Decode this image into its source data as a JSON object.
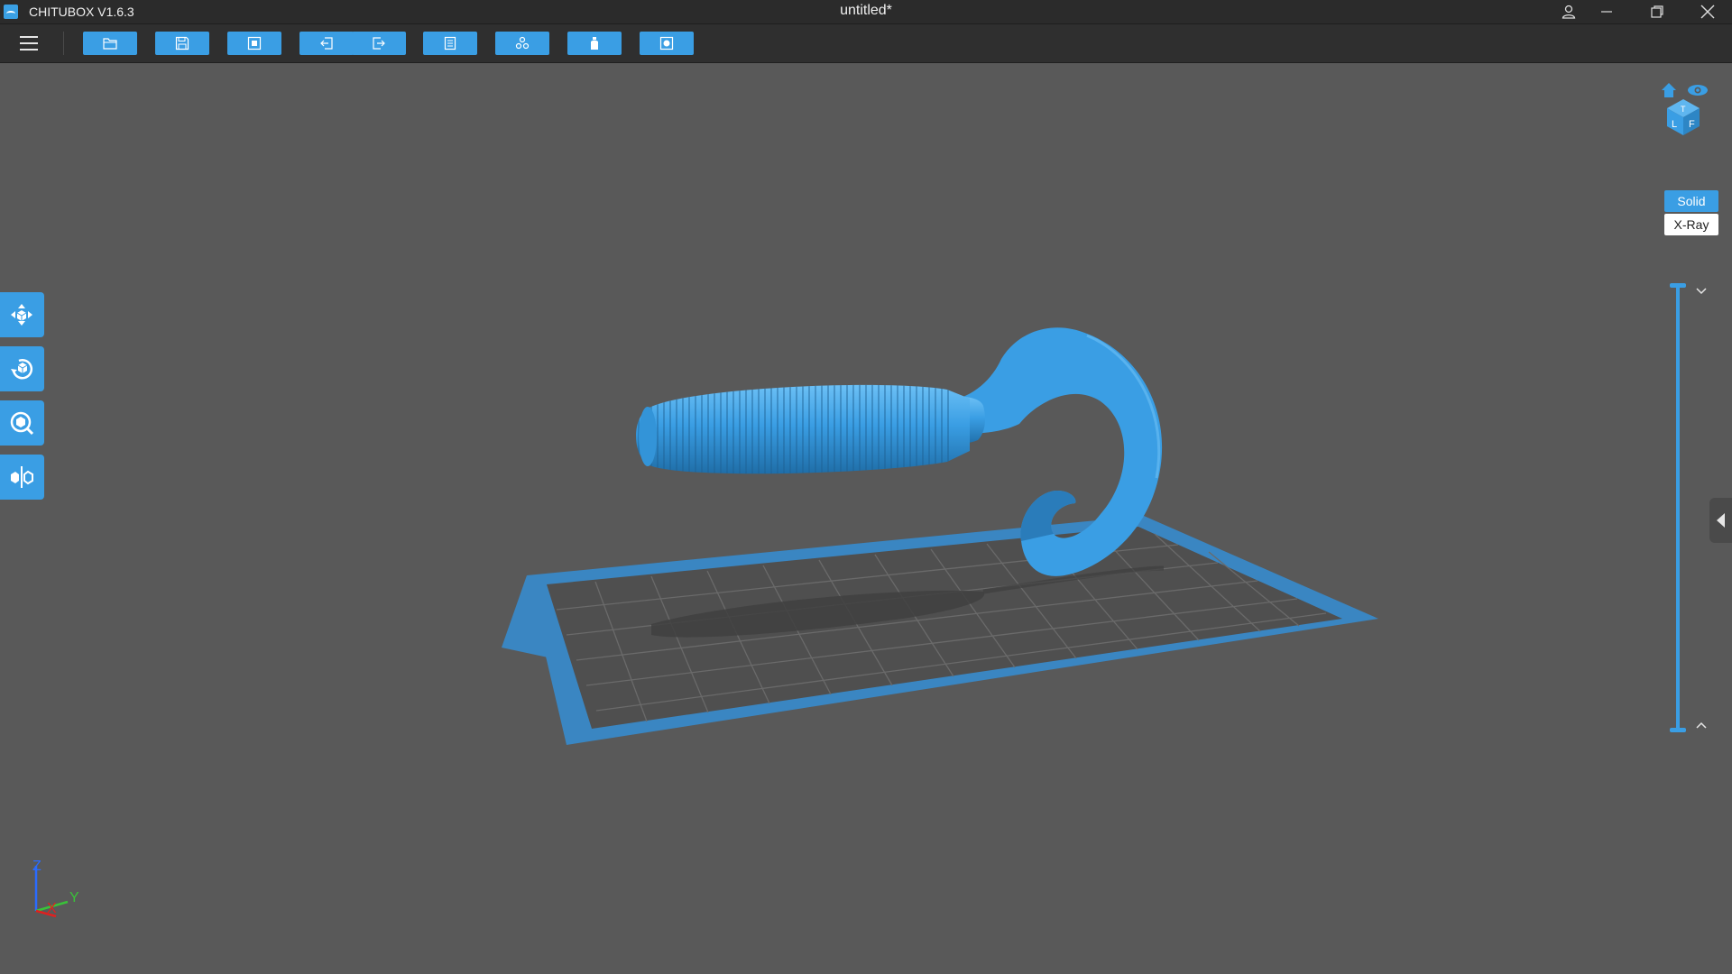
{
  "window": {
    "app_title": "CHITUBOX V1.6.3",
    "document_title": "untitled*"
  },
  "toolbar": {
    "buttons": [
      "open-file",
      "save",
      "auto-layout",
      "undo",
      "redo",
      "settings",
      "slice",
      "supports",
      "print"
    ]
  },
  "view": {
    "modes": {
      "solid": "Solid",
      "xray": "X-Ray"
    },
    "active_mode": "Solid"
  },
  "axes": {
    "z": "Z",
    "y": "Y",
    "x": "X"
  },
  "colors": {
    "accent": "#3a9ee4",
    "model": "#3a9ee4",
    "background": "#595959",
    "plate": "#4f4f4f"
  }
}
